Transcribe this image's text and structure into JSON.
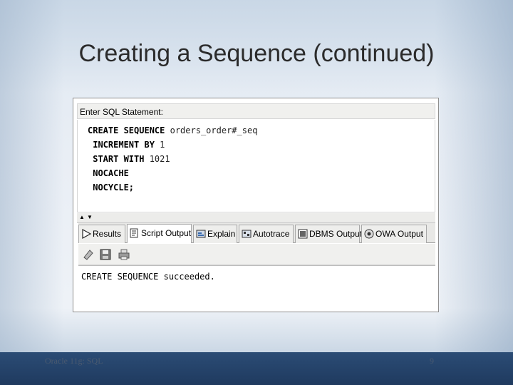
{
  "slide": {
    "title": "Creating a Sequence (continued)",
    "footer_left": "Oracle 11g: SQL",
    "page_number": "9"
  },
  "sql_panel": {
    "label": "Enter SQL Statement:",
    "code": [
      {
        "keyword": "CREATE SEQUENCE",
        "rest": " orders_order#_seq"
      },
      {
        "keyword": " INCREMENT BY",
        "rest": " 1"
      },
      {
        "keyword": " START WITH",
        "rest": " 1021"
      },
      {
        "keyword": " NOCACHE",
        "rest": ""
      },
      {
        "keyword": " NOCYCLE;",
        "rest": ""
      }
    ]
  },
  "tabs": [
    {
      "label": "Results",
      "icon": "play-arrow-icon",
      "active": false
    },
    {
      "label": "Script Output",
      "icon": "script-output-icon",
      "active": true
    },
    {
      "label": "Explain",
      "icon": "explain-plan-icon",
      "active": false
    },
    {
      "label": "Autotrace",
      "icon": "autotrace-icon",
      "active": false
    },
    {
      "label": "DBMS Output",
      "icon": "dbms-output-icon",
      "active": false
    },
    {
      "label": "OWA Output",
      "icon": "owa-output-icon",
      "active": false
    }
  ],
  "toolbar": {
    "buttons": [
      {
        "name": "eraser-icon"
      },
      {
        "name": "save-icon"
      },
      {
        "name": "print-icon"
      }
    ]
  },
  "output": {
    "text": "CREATE SEQUENCE succeeded."
  },
  "colors": {
    "footer_bar": "#1f3a5f",
    "title_text": "#2b2b2b"
  }
}
